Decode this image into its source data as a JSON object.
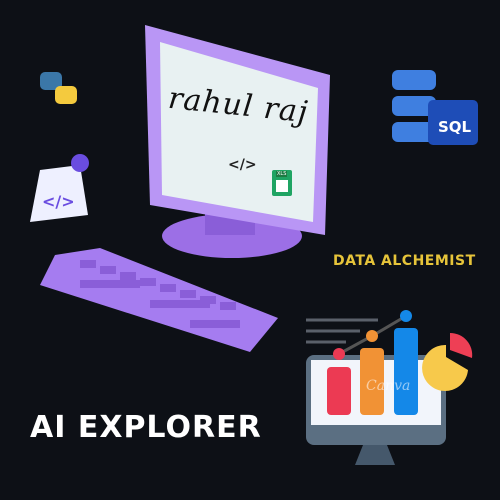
{
  "signature": "rahul raj",
  "code_symbol": "</>",
  "sheet_badge": "XLS",
  "sql_label": "SQL",
  "tagline": "DATA ALCHEMIST",
  "headline": "AI EXPLORER",
  "watermark": "Canva",
  "colors": {
    "background": "#0d1016",
    "purple": "#a57cf0",
    "tagline": "#e6c43a",
    "headline": "#ffffff"
  }
}
